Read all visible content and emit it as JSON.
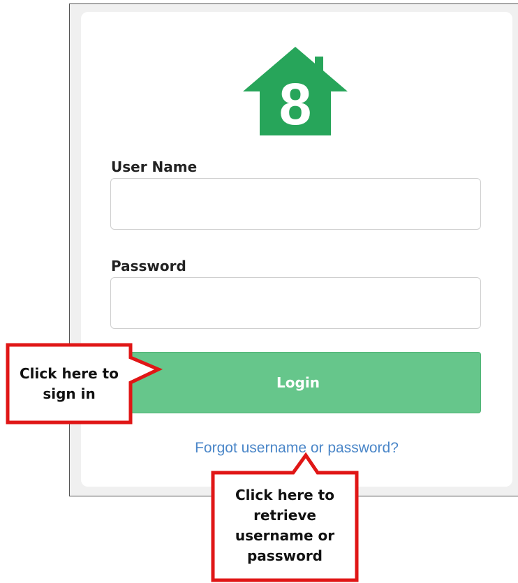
{
  "form": {
    "username_label": "User Name",
    "username_value": "",
    "password_label": "Password",
    "password_value": "",
    "login_label": "Login",
    "forgot_link": "Forgot username or password?"
  },
  "logo": {
    "glyph": "8",
    "color": "#27a55a"
  },
  "callouts": {
    "sign_in": "Click here to sign in",
    "retrieve": "Click here to retrieve username or password"
  },
  "colors": {
    "accent_green": "#66c68b",
    "link_blue": "#4a86c8",
    "callout_red": "#e01616"
  }
}
